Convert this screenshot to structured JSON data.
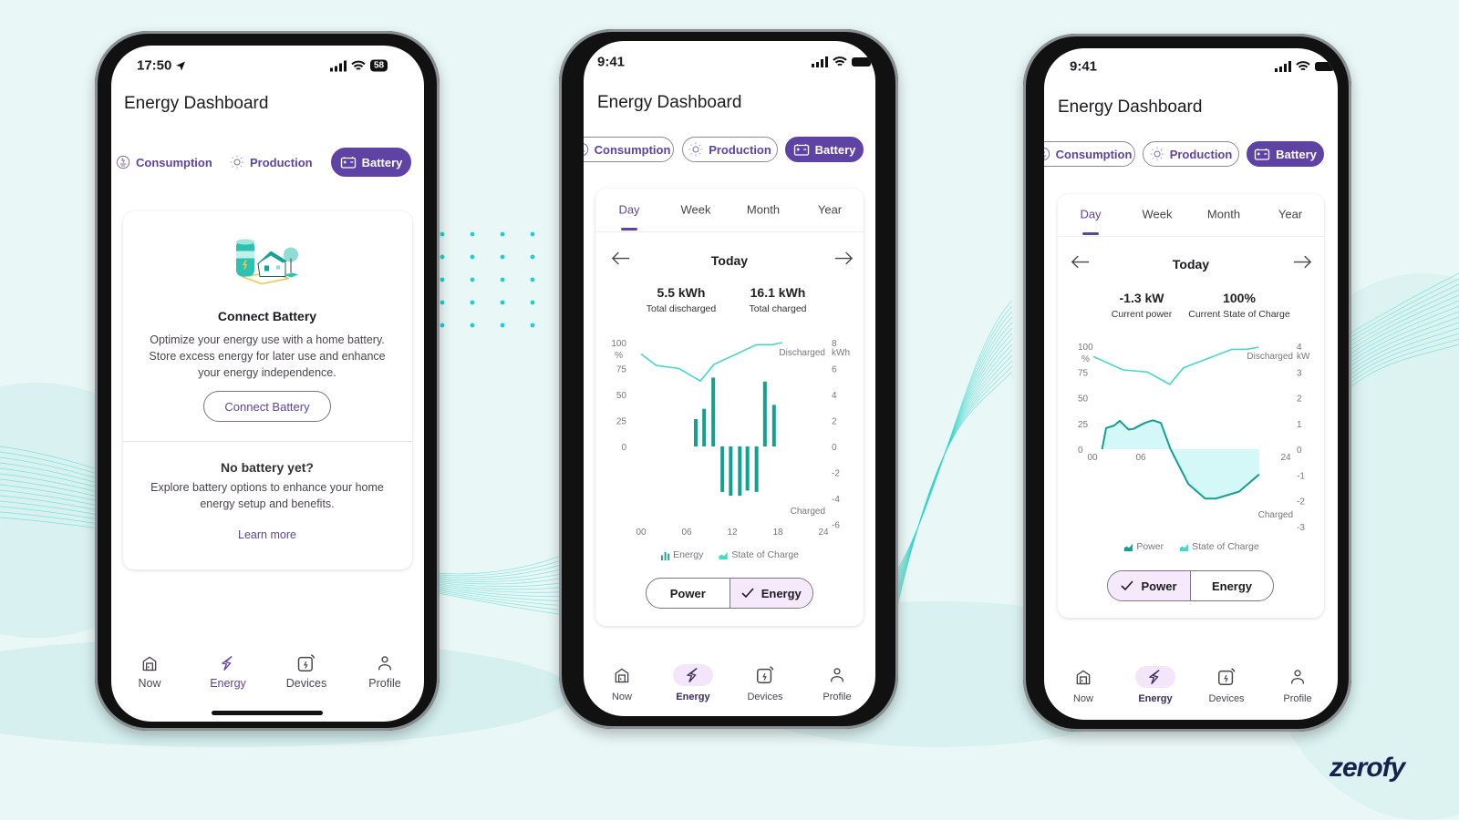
{
  "brand": {
    "logo": "zerofy"
  },
  "colors": {
    "background": "#e9f7f6",
    "accent": "#5e43a5",
    "selected_bg": "#f5e9fb",
    "soc_line": "#45d8c8",
    "energy_bar": "#12a08f",
    "power_line": "#13a08e",
    "power_fill": "#d4f8f8",
    "decor": "#2fd3c8"
  },
  "phones": [
    {
      "status": {
        "time": "17:50",
        "battery": "58",
        "icons": [
          "location-arrow-icon",
          "signal-icon",
          "wifi-icon",
          "battery-icon"
        ]
      },
      "title": "Energy Dashboard",
      "tabs": [
        {
          "label": "Consumption",
          "icon": "consumption-icon",
          "active": false
        },
        {
          "label": "Production",
          "icon": "sun-icon",
          "active": false
        },
        {
          "label": "Battery",
          "icon": "battery-icon",
          "active": true
        }
      ],
      "connect": {
        "title": "Connect Battery",
        "description": "Optimize your energy use with a home battery. Store excess energy for later use and enhance your energy independence.",
        "button": "Connect Battery"
      },
      "no_battery": {
        "title": "No battery yet?",
        "description": "Explore battery options to enhance your home energy setup and benefits.",
        "link": "Learn more"
      },
      "nav": [
        {
          "label": "Now",
          "icon": "home-icon"
        },
        {
          "label": "Energy",
          "icon": "bolt-icon",
          "active": true
        },
        {
          "label": "Devices",
          "icon": "devices-icon"
        },
        {
          "label": "Profile",
          "icon": "profile-icon"
        }
      ]
    },
    {
      "status": {
        "time": "9:41"
      },
      "title": "Energy Dashboard",
      "tabs": [
        {
          "label": "Consumption",
          "icon": "consumption-icon",
          "active": false
        },
        {
          "label": "Production",
          "icon": "sun-icon",
          "active": false
        },
        {
          "label": "Battery",
          "icon": "battery-icon",
          "active": true
        }
      ],
      "periods": [
        {
          "label": "Day",
          "active": true
        },
        {
          "label": "Week"
        },
        {
          "label": "Month"
        },
        {
          "label": "Year"
        }
      ],
      "period_label": "Today",
      "stats": [
        {
          "value": "5.5 kWh",
          "label": "Total discharged"
        },
        {
          "value": "16.1 kWh",
          "label": "Total charged"
        }
      ],
      "toggle": [
        {
          "label": "Power",
          "selected": false
        },
        {
          "label": "Energy",
          "selected": true
        }
      ],
      "nav": [
        {
          "label": "Now",
          "icon": "home-icon"
        },
        {
          "label": "Energy",
          "icon": "bolt-icon",
          "active": true
        },
        {
          "label": "Devices",
          "icon": "devices-icon"
        },
        {
          "label": "Profile",
          "icon": "profile-icon"
        }
      ]
    },
    {
      "status": {
        "time": "9:41"
      },
      "title": "Energy Dashboard",
      "tabs": [
        {
          "label": "Consumption",
          "icon": "consumption-icon",
          "active": false
        },
        {
          "label": "Production",
          "icon": "sun-icon",
          "active": false
        },
        {
          "label": "Battery",
          "icon": "battery-icon",
          "active": true
        }
      ],
      "periods": [
        {
          "label": "Day",
          "active": true
        },
        {
          "label": "Week"
        },
        {
          "label": "Month"
        },
        {
          "label": "Year"
        }
      ],
      "period_label": "Today",
      "stats": [
        {
          "value": "-1.3 kW",
          "label": "Current power"
        },
        {
          "value": "100%",
          "label": "Current State of Charge"
        }
      ],
      "toggle": [
        {
          "label": "Power",
          "selected": true
        },
        {
          "label": "Energy",
          "selected": false
        }
      ],
      "nav": [
        {
          "label": "Now",
          "icon": "home-icon"
        },
        {
          "label": "Energy",
          "icon": "bolt-icon",
          "active": true
        },
        {
          "label": "Devices",
          "icon": "devices-icon"
        },
        {
          "label": "Profile",
          "icon": "profile-icon"
        }
      ]
    }
  ],
  "chart_data": [
    {
      "type": "bar+line",
      "x_ticks": [
        "00",
        "06",
        "12",
        "18",
        "24"
      ],
      "xlim": [
        0,
        24
      ],
      "left_axis": {
        "unit": "%",
        "ticks": [
          0,
          25,
          50,
          75,
          100
        ],
        "ylim": [
          0,
          100
        ]
      },
      "right_axis": {
        "unit": "kWh",
        "ticks": [
          -6,
          -4,
          -2,
          0,
          2,
          4,
          6,
          8
        ],
        "ylim": [
          -6,
          8
        ],
        "top_label": "Discharged",
        "bottom_label": "Charged"
      },
      "grid": false,
      "legend_placement": "bottom",
      "series": [
        {
          "name": "Energy",
          "type": "bar",
          "axis": "right",
          "x": [
            7.2,
            8.3,
            9.5,
            10.7,
            11.8,
            13,
            14,
            15.2,
            16.3,
            17.5
          ],
          "values": [
            2.1,
            2.9,
            5.3,
            -3.5,
            -3.8,
            -3.8,
            -3.4,
            -3.5,
            5.0,
            3.2
          ]
        },
        {
          "name": "State of Charge",
          "type": "line",
          "axis": "left",
          "x": [
            0,
            2,
            5,
            7.8,
            9.6,
            15.2,
            17.3,
            18.6
          ],
          "values": [
            89,
            78,
            75,
            63,
            79,
            98,
            98,
            100
          ]
        }
      ]
    },
    {
      "type": "area+line",
      "x_ticks": [
        "00",
        "06",
        "12",
        "18",
        "24"
      ],
      "xlim": [
        0,
        24
      ],
      "left_axis": {
        "unit": "%",
        "ticks": [
          0,
          25,
          50,
          75,
          100
        ],
        "ylim": [
          0,
          100
        ]
      },
      "right_axis": {
        "unit": "kW",
        "ticks": [
          -3,
          -2,
          -1,
          0,
          1,
          2,
          3,
          4
        ],
        "ylim": [
          -3,
          4
        ],
        "top_label": "Discharged",
        "bottom_label": "Charged"
      },
      "grid": false,
      "legend_placement": "bottom",
      "series": [
        {
          "name": "Power",
          "type": "area",
          "axis": "right",
          "x": [
            1.2,
            1.7,
            2.7,
            3.4,
            4.5,
            5.1,
            6.5,
            7.5,
            8.5,
            9.7,
            11.9,
            14,
            15.3,
            18.2,
            20.7
          ],
          "values": [
            0,
            0.82,
            0.92,
            1.1,
            0.76,
            0.79,
            1.02,
            1.12,
            1.02,
            0,
            -1.35,
            -1.92,
            -1.92,
            -1.65,
            -0.98
          ]
        },
        {
          "name": "State of Charge",
          "type": "line",
          "axis": "left",
          "x": [
            0.1,
            3.8,
            6.8,
            9.6,
            11.3,
            17.3,
            19.1,
            20.6
          ],
          "values": [
            90,
            77,
            75,
            63,
            79,
            97,
            97,
            99
          ]
        }
      ]
    }
  ]
}
